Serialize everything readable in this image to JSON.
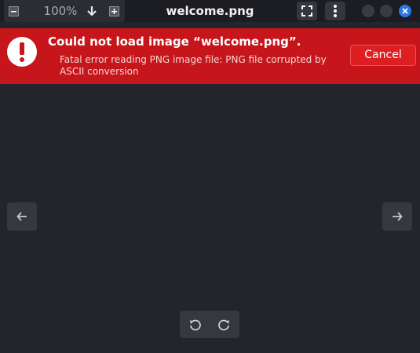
{
  "window": {
    "title": "welcome.png"
  },
  "toolbar": {
    "zoom_value": "100%",
    "icons": {
      "zoom_out": "minus-square-icon",
      "zoom_menu": "arrow-down-icon",
      "zoom_in": "plus-square-icon",
      "fullscreen": "fullscreen-icon",
      "menu": "kebab-menu-icon"
    }
  },
  "error": {
    "title": "Could not load image “welcome.png”.",
    "detail": "Fatal error reading PNG image file: PNG file corrupted by ASCII conversion",
    "cancel_label": "Cancel",
    "icon": "exclamation-circle-icon"
  },
  "navigation": {
    "prev_icon": "arrow-left-icon",
    "next_icon": "arrow-right-icon"
  },
  "rotate": {
    "left_icon": "rotate-left-icon",
    "right_icon": "rotate-right-icon"
  },
  "colors": {
    "background": "#24252c",
    "error_bar": "#c7161b",
    "cancel_button": "#dd1f22",
    "close_button": "#2b78e4"
  }
}
